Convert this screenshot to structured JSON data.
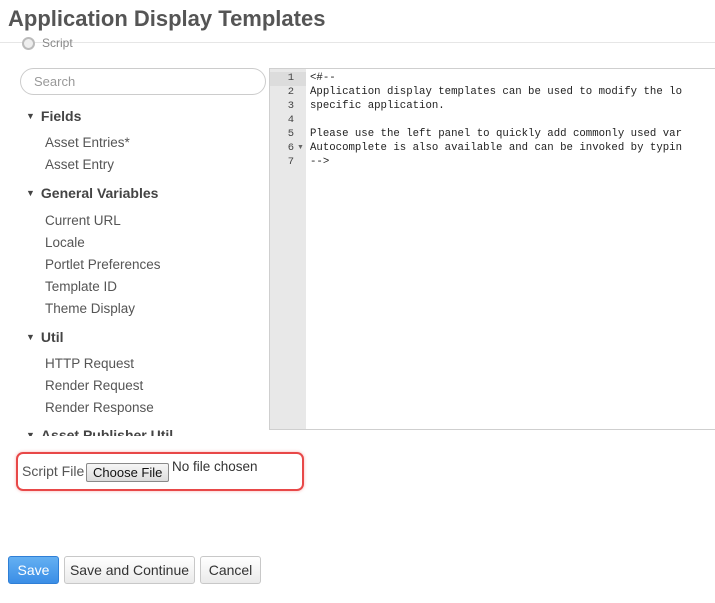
{
  "page": {
    "title": "Application Display Templates"
  },
  "language_option": {
    "label": "Script"
  },
  "left_panel": {
    "search_placeholder": "Search",
    "sections": [
      {
        "title": "Fields",
        "items": [
          "Asset Entries*",
          "Asset Entry"
        ]
      },
      {
        "title": "General Variables",
        "items": [
          "Current URL",
          "Locale",
          "Portlet Preferences",
          "Template ID",
          "Theme Display"
        ]
      },
      {
        "title": "Util",
        "items": [
          "HTTP Request",
          "Render Request",
          "Render Response"
        ]
      },
      {
        "title": "Asset Publisher Util",
        "items": []
      }
    ]
  },
  "editor": {
    "line_numbers": [
      "1",
      "2",
      "3",
      "4",
      "5",
      "6",
      "7"
    ],
    "lines": [
      "<#--",
      "Application display templates can be used to modify the lo",
      "specific application.",
      "",
      "Please use the left panel to quickly add commonly used var",
      "Autocomplete is also available and can be invoked by typin",
      "-->"
    ]
  },
  "script_file": {
    "label": "Script File",
    "button_label": "Choose File",
    "status": "No file chosen",
    "highlight_color": "#e84848"
  },
  "actions": {
    "save": "Save",
    "save_continue": "Save and Continue",
    "cancel": "Cancel",
    "primary_color": "#3b8ee6"
  }
}
